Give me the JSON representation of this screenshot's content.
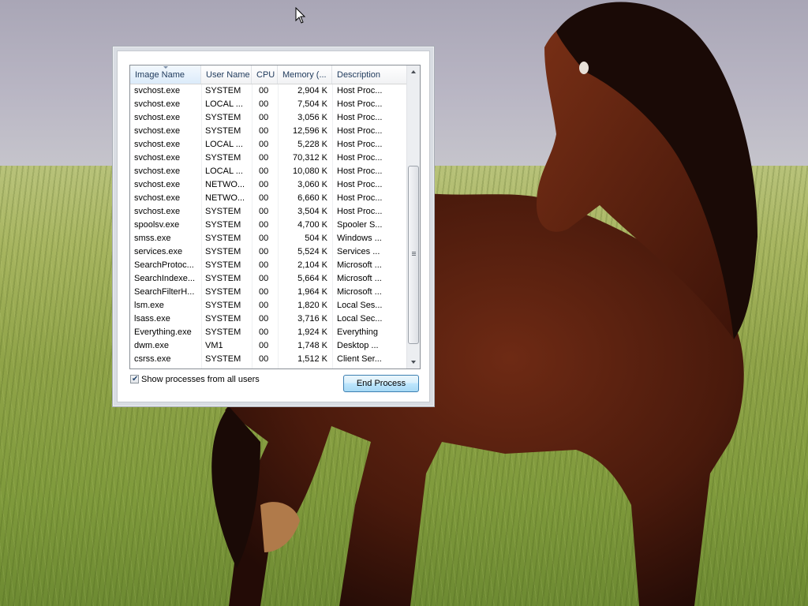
{
  "columns": {
    "image_name": "Image Name",
    "user_name": "User Name",
    "cpu": "CPU",
    "memory": "Memory (...",
    "description": "Description"
  },
  "processes": [
    {
      "name": "svchost.exe",
      "user": "SYSTEM",
      "cpu": "00",
      "memory": "2,904 K",
      "description": "Host Proc..."
    },
    {
      "name": "svchost.exe",
      "user": "LOCAL ...",
      "cpu": "00",
      "memory": "7,504 K",
      "description": "Host Proc..."
    },
    {
      "name": "svchost.exe",
      "user": "SYSTEM",
      "cpu": "00",
      "memory": "3,056 K",
      "description": "Host Proc..."
    },
    {
      "name": "svchost.exe",
      "user": "SYSTEM",
      "cpu": "00",
      "memory": "12,596 K",
      "description": "Host Proc..."
    },
    {
      "name": "svchost.exe",
      "user": "LOCAL ...",
      "cpu": "00",
      "memory": "5,228 K",
      "description": "Host Proc..."
    },
    {
      "name": "svchost.exe",
      "user": "SYSTEM",
      "cpu": "00",
      "memory": "70,312 K",
      "description": "Host Proc..."
    },
    {
      "name": "svchost.exe",
      "user": "LOCAL ...",
      "cpu": "00",
      "memory": "10,080 K",
      "description": "Host Proc..."
    },
    {
      "name": "svchost.exe",
      "user": "NETWO...",
      "cpu": "00",
      "memory": "3,060 K",
      "description": "Host Proc..."
    },
    {
      "name": "svchost.exe",
      "user": "NETWO...",
      "cpu": "00",
      "memory": "6,660 K",
      "description": "Host Proc..."
    },
    {
      "name": "svchost.exe",
      "user": "SYSTEM",
      "cpu": "00",
      "memory": "3,504 K",
      "description": "Host Proc..."
    },
    {
      "name": "spoolsv.exe",
      "user": "SYSTEM",
      "cpu": "00",
      "memory": "4,700 K",
      "description": "Spooler S..."
    },
    {
      "name": "smss.exe",
      "user": "SYSTEM",
      "cpu": "00",
      "memory": "504 K",
      "description": "Windows ..."
    },
    {
      "name": "services.exe",
      "user": "SYSTEM",
      "cpu": "00",
      "memory": "5,524 K",
      "description": "Services ..."
    },
    {
      "name": "SearchProtoc...",
      "user": "SYSTEM",
      "cpu": "00",
      "memory": "2,104 K",
      "description": "Microsoft ..."
    },
    {
      "name": "SearchIndexe...",
      "user": "SYSTEM",
      "cpu": "00",
      "memory": "5,664 K",
      "description": "Microsoft ..."
    },
    {
      "name": "SearchFilterH...",
      "user": "SYSTEM",
      "cpu": "00",
      "memory": "1,964 K",
      "description": "Microsoft ..."
    },
    {
      "name": "lsm.exe",
      "user": "SYSTEM",
      "cpu": "00",
      "memory": "1,820 K",
      "description": "Local Ses..."
    },
    {
      "name": "lsass.exe",
      "user": "SYSTEM",
      "cpu": "00",
      "memory": "3,716 K",
      "description": "Local Sec..."
    },
    {
      "name": "Everything.exe",
      "user": "SYSTEM",
      "cpu": "00",
      "memory": "1,924 K",
      "description": "Everything"
    },
    {
      "name": "dwm.exe",
      "user": "VM1",
      "cpu": "00",
      "memory": "1,748 K",
      "description": "Desktop ..."
    },
    {
      "name": "csrss.exe",
      "user": "SYSTEM",
      "cpu": "00",
      "memory": "1,512 K",
      "description": "Client Ser..."
    }
  ],
  "show_all_users": {
    "label": "Show processes from all users",
    "checked": true
  },
  "end_process_label": "End Process",
  "icons": {
    "cursor": "mouse-pointer-icon",
    "scroll_up": "chevron-up-icon",
    "scroll_down": "chevron-down-icon",
    "checkbox": "checkmark-icon"
  },
  "colors": {
    "panel_bg": "#d9dde3",
    "header_text": "#1e395b",
    "button_border": "#3c7fb1"
  }
}
